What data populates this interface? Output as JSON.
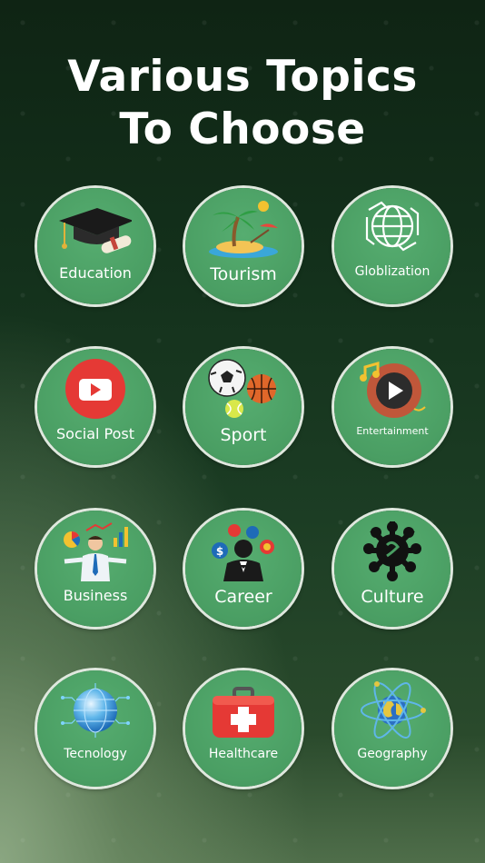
{
  "header": {
    "title_line1": "Various Topics",
    "title_line2": "To Choose"
  },
  "topics": [
    {
      "label": "Education"
    },
    {
      "label": "Tourism"
    },
    {
      "label": "Globlization"
    },
    {
      "label": "Social Post"
    },
    {
      "label": "Sport"
    },
    {
      "label": "Entertainment"
    },
    {
      "label": "Business"
    },
    {
      "label": "Career"
    },
    {
      "label": "Culture"
    },
    {
      "label": "Tecnology"
    },
    {
      "label": "Healthcare"
    },
    {
      "label": "Geography"
    }
  ],
  "icons": [
    "graduation-cap-icon",
    "island-icon",
    "globe-hands-icon",
    "play-button-icon",
    "sport-balls-icon",
    "music-play-icon",
    "business-man-icon",
    "career-man-icon",
    "culture-tree-icon",
    "tech-globe-icon",
    "first-aid-kit-icon",
    "atom-globe-icon"
  ],
  "colors": {
    "background": "#13301b",
    "circle": "#4a9e63",
    "ring": "#dfe8de",
    "text": "#ffffff"
  }
}
